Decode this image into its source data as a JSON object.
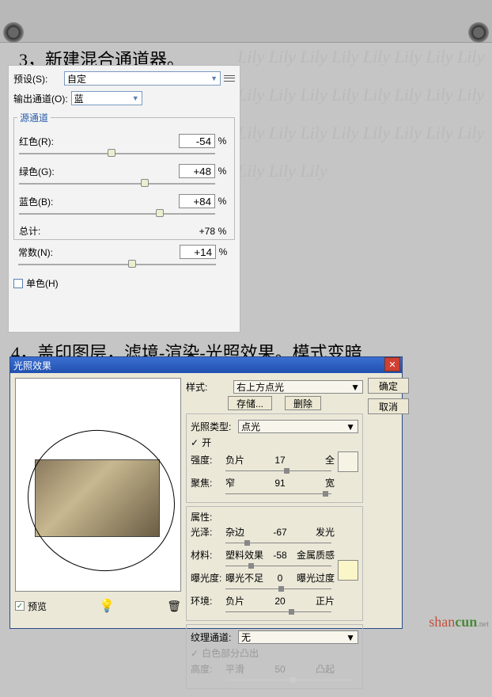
{
  "watermark": "Lily Lily Lily Lily Lily Lily Lily Lily Lily Lily Lily Lily Lily Lily Lily Lily Lily Lily Lily Lily Lily Lily Lily Lily Lily Lily Lily Lily Lily Lily Lily Lily Lily Lily Lily",
  "heading1": "3，新建混合通道器。",
  "heading2": "4，盖印图层，滤境-渲染-光照效果。模式变暗",
  "mixer": {
    "preset_lbl": "预设(S):",
    "preset_val": "自定",
    "out_lbl": "输出通道(O):",
    "out_val": "蓝",
    "group": "源通道",
    "red_lbl": "红色(R):",
    "red_val": "-54",
    "green_lbl": "绿色(G):",
    "green_val": "+48",
    "blue_lbl": "蓝色(B):",
    "blue_val": "+84",
    "total_lbl": "总计:",
    "total_val": "+78",
    "const_lbl": "常数(N):",
    "const_val": "+14",
    "pct": "%",
    "mono": "单色(H)"
  },
  "light": {
    "title": "光照效果",
    "ok": "确定",
    "cancel": "取消",
    "style_lbl": "样式:",
    "style_val": "右上方点光",
    "save": "存储...",
    "delete": "删除",
    "type_lbl": "光照类型:",
    "type_val": "点光",
    "on": "开",
    "intensity_lbl": "强度:",
    "intensity_a": "负片",
    "intensity_v": "17",
    "intensity_b": "全",
    "focus_lbl": "聚焦:",
    "focus_a": "窄",
    "focus_v": "91",
    "focus_b": "宽",
    "props": "属性:",
    "gloss_lbl": "光泽:",
    "gloss_a": "杂边",
    "gloss_v": "-67",
    "gloss_b": "发光",
    "material_lbl": "材料:",
    "material_a": "塑料效果",
    "material_v": "-58",
    "material_b": "金属质感",
    "exposure_lbl": "曝光度:",
    "exposure_a": "曝光不足",
    "exposure_v": "0",
    "exposure_b": "曝光过度",
    "ambient_lbl": "环境:",
    "ambient_a": "负片",
    "ambient_v": "20",
    "ambient_b": "正片",
    "texture_lbl": "纹理通道:",
    "texture_val": "无",
    "white_high": "白色部分凸出",
    "height_lbl": "高度:",
    "height_a": "平滑",
    "height_v": "50",
    "height_b": "凸起",
    "preview_cb": "预览",
    "swatch1": "#f7f3e4",
    "swatch2": "#fbf6c8"
  },
  "logo": {
    "a": "shan",
    "b": "cun",
    "c": ".net"
  }
}
